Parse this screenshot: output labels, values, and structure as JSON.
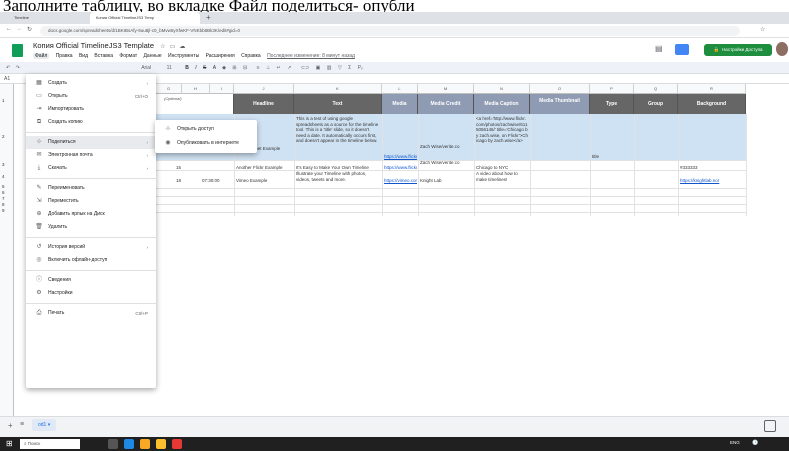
{
  "caption": "Заполните таблицу, во вкладке Файл поделиться- опубли",
  "browser": {
    "tabs": [
      "Timeline",
      "Копия Official TimelineJS3 Temp"
    ],
    "url": "docs.google.com/spreadsheets/d/1BKIBsAfy-9uu8jl-c0_bMvw5yXfwKF-VNKbb8Bk3K/edit#gid=0"
  },
  "app": {
    "title": "Копия Official TimelineJS3 Template",
    "menu": [
      "Файл",
      "Правка",
      "Вид",
      "Вставка",
      "Формат",
      "Данные",
      "Инструменты",
      "Расширения",
      "Справка"
    ],
    "last_edit": "Последнее изменение: 8 минут назад",
    "share_label": "Настройки Доступа",
    "cell_ref": "A1",
    "font_name": "Arial",
    "font_size": "11"
  },
  "file_menu": {
    "items": [
      {
        "icon": "▦",
        "label": "Создать",
        "right": "›"
      },
      {
        "icon": "▭",
        "label": "Открыть",
        "right": "Ctrl+O"
      },
      {
        "icon": "⇥",
        "label": "Импортировать",
        "right": ""
      },
      {
        "icon": "⧉",
        "label": "Создать копию",
        "right": ""
      },
      {
        "icon": "⊹",
        "label": "Поделиться",
        "right": "›"
      },
      {
        "icon": "✉",
        "label": "Электронная почта",
        "right": "›"
      },
      {
        "icon": "⤓",
        "label": "Скачать",
        "right": "›"
      },
      {
        "icon": "✎",
        "label": "Переименовать",
        "right": ""
      },
      {
        "icon": "⇲",
        "label": "Переместить",
        "right": ""
      },
      {
        "icon": "⊕",
        "label": "Добавить ярлык на Диск",
        "right": ""
      },
      {
        "icon": "🗑",
        "label": "Удалить",
        "right": ""
      },
      {
        "icon": "↺",
        "label": "История версий",
        "right": "›"
      },
      {
        "icon": "◎",
        "label": "Включить офлайн-доступ",
        "right": ""
      },
      {
        "icon": "ⓘ",
        "label": "Сведения",
        "right": ""
      },
      {
        "icon": "⚙",
        "label": "Настройки",
        "right": ""
      },
      {
        "icon": "⎙",
        "label": "Печать",
        "right": "Ctrl+P"
      }
    ],
    "share_submenu": [
      {
        "icon": "⊹",
        "label": "Открыть доступ"
      },
      {
        "icon": "◉",
        "label": "Опубликовать в интернете"
      }
    ]
  },
  "sheet": {
    "columns": [
      "G",
      "H",
      "I",
      "J",
      "K",
      "L",
      "M",
      "N",
      "O",
      "P",
      "Q",
      "R"
    ],
    "row_numbers": [
      "1",
      "2",
      "3",
      "4",
      "5",
      "6",
      "7",
      "8",
      "9"
    ],
    "headers": [
      "Headline",
      "Text",
      "Media",
      "Media Credit",
      "Media Caption",
      "Media Thumbnail",
      "Type",
      "Group",
      "Background"
    ],
    "optional_note": "(Optional)",
    "row2": {
      "headline": "Spreadsheet Example",
      "text": "This is a test of using google spreadsheets as a source for the timeline tool. This is a 'title' slide, so it doesn't need a date. It automatically occurs first, and doesn't appear in the timeline below.",
      "media": "https://www.flickr.co",
      "credit": "Zach Wise/verite.co",
      "caption": "<a href='http://www.flickr.com/photos/zachwise/6115056146/' title='Chicago by zach.wise, on Flickr'>Chicago by zach.wise</a>",
      "type": "title"
    },
    "row3": {
      "col_g": "15",
      "col_h": "18",
      "time": "07:30:00",
      "headline": "Another Flickr Example",
      "text": "It's Easy to Make Your Own Timeline",
      "media": "https://www.flickr.co",
      "credit": "Zach Wise/verite.co",
      "caption": "Chicago to NYC",
      "background": "#333333"
    },
    "row4": {
      "headline": "Vimeo Example",
      "text": "Illustrate your Timeline with photos, videos, tweets and more.",
      "media": "https://vimeo.com/1",
      "credit": "Knight Lab",
      "caption": "A video about how to make timelines!",
      "background": "https://knightlab.nor"
    }
  },
  "sheets_bar": {
    "tab": "od1"
  },
  "taskbar": {
    "search": "Поиск",
    "lang": "ENG"
  }
}
